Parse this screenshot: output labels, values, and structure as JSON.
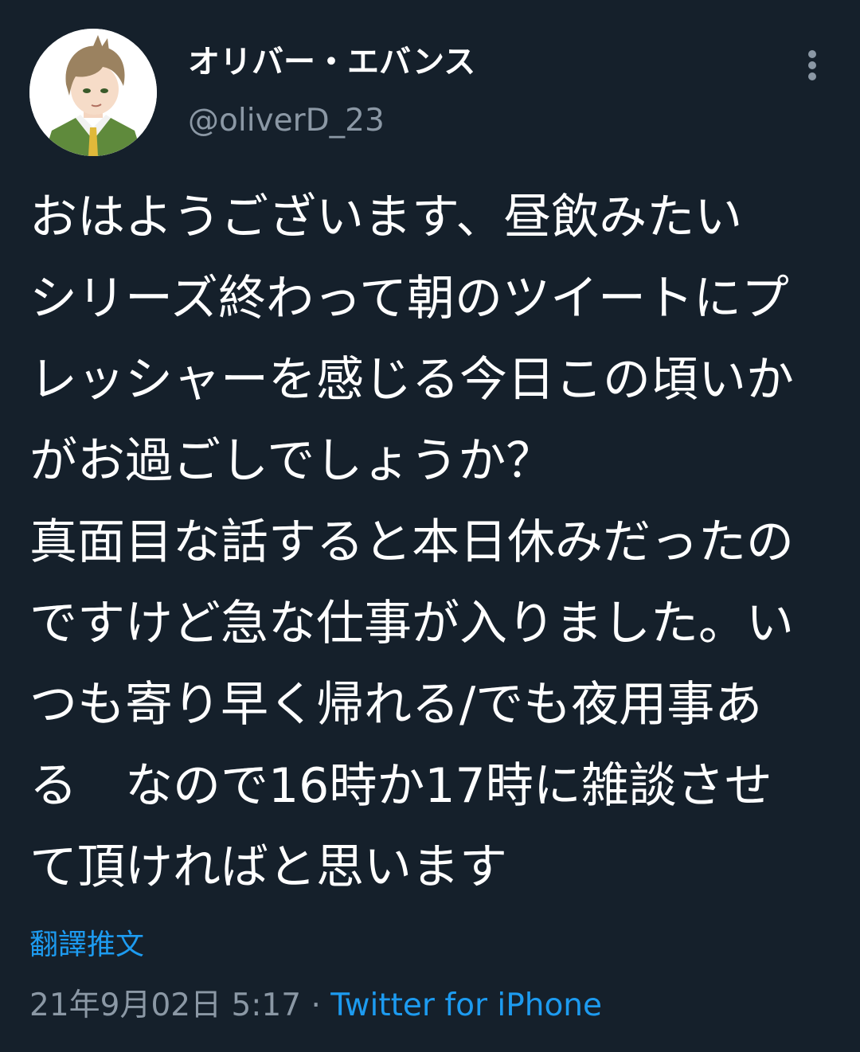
{
  "author": {
    "display_name": "オリバー・エバンス",
    "handle": "@oliverD_23"
  },
  "tweet": {
    "lines": [
      "おはようございます、昼飲みたい",
      "シリーズ終わって朝のツイートにプ",
      "レッシャーを感じる今日この頃いか",
      "がお過ごしでしょうか？",
      "真面目な話すると本日休みだったの",
      "ですけど急な仕事が入りました。い",
      "つも寄り早く帰れる/でも夜用事あ",
      "る　なので16時か17時に雑談させ",
      "て頂ければと思います"
    ]
  },
  "translate_label": "翻譯推文",
  "meta": {
    "timestamp": "21年9月02日 5:17",
    "separator": " · ",
    "source": "Twitter for iPhone"
  },
  "icons": {
    "more": "more-vertical-icon",
    "avatar": "anime-character-avatar"
  },
  "colors": {
    "background": "#15202b",
    "text": "#ffffff",
    "secondary": "#8b98a5",
    "link": "#1d9bf0"
  }
}
